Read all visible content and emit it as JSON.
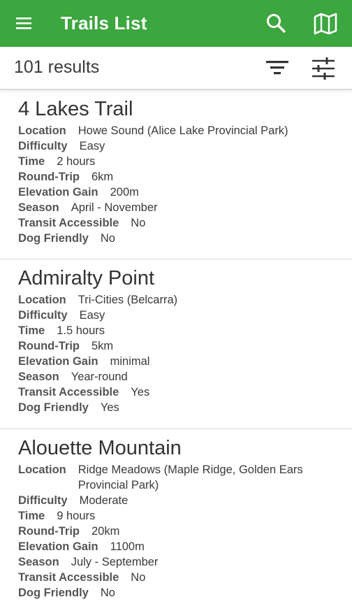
{
  "appbar": {
    "title": "Trails List",
    "background": "#3ca63f",
    "icons": [
      "menu-icon",
      "search-icon",
      "map-icon"
    ]
  },
  "results": {
    "count_text": "101 results",
    "icons": [
      "filter-icon",
      "tune-icon"
    ]
  },
  "labels": {
    "location": "Location",
    "difficulty": "Difficulty",
    "time": "Time",
    "round_trip": "Round-Trip",
    "elevation_gain": "Elevation Gain",
    "season": "Season",
    "transit": "Transit Accessible",
    "dog": "Dog Friendly"
  },
  "trails": [
    {
      "name": "4 Lakes Trail",
      "location": "Howe Sound (Alice Lake Provincial Park)",
      "difficulty": "Easy",
      "time": "2 hours",
      "round_trip": "6km",
      "elevation_gain": "200m",
      "season": "April - November",
      "transit": "No",
      "dog": "No"
    },
    {
      "name": "Admiralty Point",
      "location": "Tri-Cities (Belcarra)",
      "difficulty": "Easy",
      "time": "1.5 hours",
      "round_trip": "5km",
      "elevation_gain": "minimal",
      "season": "Year-round",
      "transit": "Yes",
      "dog": "Yes"
    },
    {
      "name": "Alouette Mountain",
      "location": "Ridge Meadows (Maple Ridge, Golden Ears Provincial Park)",
      "difficulty": "Moderate",
      "time": "9 hours",
      "round_trip": "20km",
      "elevation_gain": "1100m",
      "season": "July - September",
      "transit": "No",
      "dog": "No"
    }
  ]
}
